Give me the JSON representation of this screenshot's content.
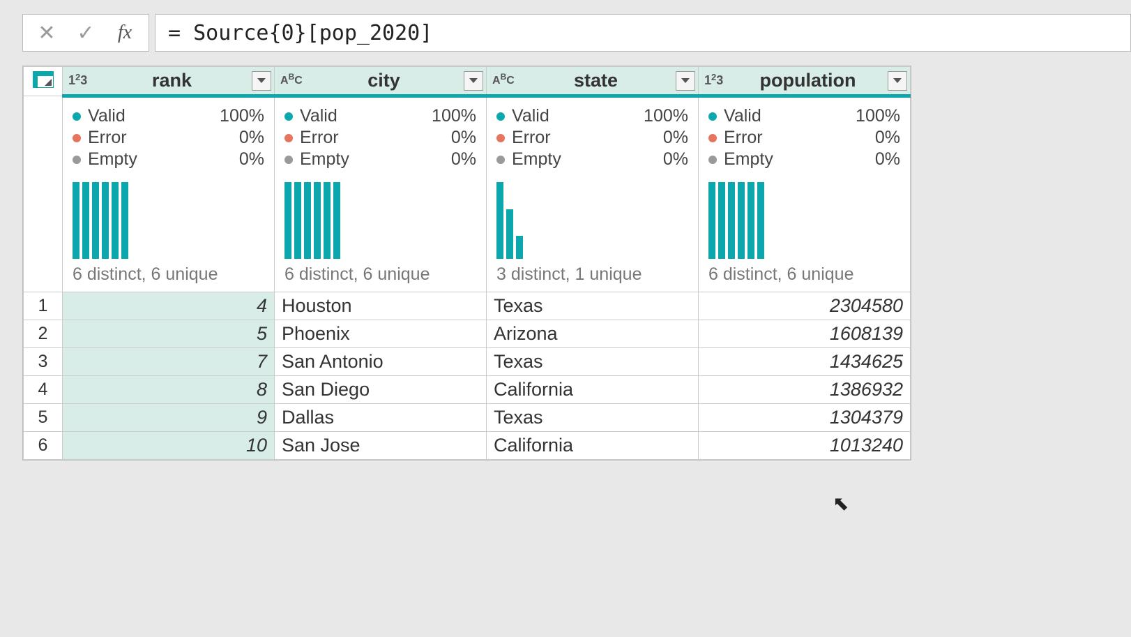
{
  "formula_bar": {
    "expression": "= Source{0}[pop_2020]"
  },
  "columns": [
    {
      "key": "rank",
      "label": "rank",
      "type": "number",
      "quality": {
        "valid": "100%",
        "error": "0%",
        "empty": "0%"
      },
      "histogram_heights": [
        100,
        100,
        100,
        100,
        100,
        100
      ],
      "distinct": "6 distinct, 6 unique"
    },
    {
      "key": "city",
      "label": "city",
      "type": "text",
      "quality": {
        "valid": "100%",
        "error": "0%",
        "empty": "0%"
      },
      "histogram_heights": [
        100,
        100,
        100,
        100,
        100,
        100
      ],
      "distinct": "6 distinct, 6 unique"
    },
    {
      "key": "state",
      "label": "state",
      "type": "text",
      "quality": {
        "valid": "100%",
        "error": "0%",
        "empty": "0%"
      },
      "histogram_heights": [
        100,
        65,
        30
      ],
      "distinct": "3 distinct, 1 unique"
    },
    {
      "key": "population",
      "label": "population",
      "type": "number",
      "quality": {
        "valid": "100%",
        "error": "0%",
        "empty": "0%"
      },
      "histogram_heights": [
        100,
        100,
        100,
        100,
        100,
        100
      ],
      "distinct": "6 distinct, 6 unique"
    }
  ],
  "quality_labels": {
    "valid": "Valid",
    "error": "Error",
    "empty": "Empty"
  },
  "rows": [
    {
      "idx": "1",
      "rank": "4",
      "city": "Houston",
      "state": "Texas",
      "population": "2304580"
    },
    {
      "idx": "2",
      "rank": "5",
      "city": "Phoenix",
      "state": "Arizona",
      "population": "1608139"
    },
    {
      "idx": "3",
      "rank": "7",
      "city": "San Antonio",
      "state": "Texas",
      "population": "1434625"
    },
    {
      "idx": "4",
      "rank": "8",
      "city": "San Diego",
      "state": "California",
      "population": "1386932"
    },
    {
      "idx": "5",
      "rank": "9",
      "city": "Dallas",
      "state": "Texas",
      "population": "1304379"
    },
    {
      "idx": "6",
      "rank": "10",
      "city": "San Jose",
      "state": "California",
      "population": "1013240"
    }
  ],
  "chart_data": [
    {
      "type": "bar",
      "column": "rank",
      "values": [
        1,
        1,
        1,
        1,
        1,
        1
      ],
      "note": "distribution sparkline, 6 equal bars"
    },
    {
      "type": "bar",
      "column": "city",
      "values": [
        1,
        1,
        1,
        1,
        1,
        1
      ],
      "note": "distribution sparkline, 6 equal bars"
    },
    {
      "type": "bar",
      "column": "state",
      "categories": [
        "Texas",
        "California",
        "Arizona"
      ],
      "values": [
        3,
        2,
        1
      ]
    },
    {
      "type": "bar",
      "column": "population",
      "values": [
        1,
        1,
        1,
        1,
        1,
        1
      ],
      "note": "distribution sparkline, 6 equal bars"
    }
  ]
}
